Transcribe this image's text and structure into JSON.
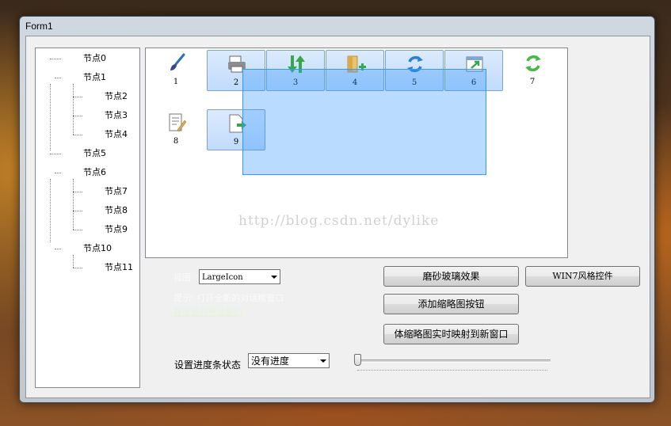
{
  "window": {
    "title": "Form1"
  },
  "tree": {
    "nodes": [
      {
        "label": "节点0"
      },
      {
        "label": "节点1"
      },
      {
        "label": "节点2"
      },
      {
        "label": "节点3"
      },
      {
        "label": "节点4"
      },
      {
        "label": "节点5"
      },
      {
        "label": "节点6"
      },
      {
        "label": "节点7"
      },
      {
        "label": "节点8"
      },
      {
        "label": "节点9"
      },
      {
        "label": "节点10"
      },
      {
        "label": "节点11"
      }
    ]
  },
  "listview": {
    "items": [
      {
        "label": "1",
        "icon": "paintbrush-icon",
        "selected": false
      },
      {
        "label": "2",
        "icon": "printer-icon",
        "selected": true
      },
      {
        "label": "3",
        "icon": "up-down-arrows-icon",
        "selected": true
      },
      {
        "label": "4",
        "icon": "folder-add-icon",
        "selected": true
      },
      {
        "label": "5",
        "icon": "refresh-icon",
        "selected": true
      },
      {
        "label": "6",
        "icon": "external-link-icon",
        "selected": true
      },
      {
        "label": "7",
        "icon": "recycle-icon",
        "selected": false
      },
      {
        "label": "8",
        "icon": "document-edit-icon",
        "selected": false
      },
      {
        "label": "9",
        "icon": "document-export-icon",
        "selected": true
      }
    ],
    "watermark": "http://blog.csdn.net/dylike"
  },
  "view_mode": {
    "label": "视图",
    "value": "LargeIcon"
  },
  "hint": {
    "line1": "提示: 打开全新的对话框窗口",
    "link": "在此处打开此窗口"
  },
  "buttons": {
    "frosted_glass": "磨砂玻璃效果",
    "win7_controls": "WIN7风格控件",
    "add_thumbnail_buttons": "添加缩略图按钮",
    "thumbnail_live_map": "体缩略图实时映射到新窗口"
  },
  "progress_state": {
    "label": "设置进度条状态",
    "value": "没有进度"
  },
  "slider": {
    "value": 0
  },
  "colors": {
    "selection": "#3399ff",
    "window_border": "#3b4a5a",
    "accent_green": "#37a84a",
    "accent_blue": "#2f7fd1"
  }
}
